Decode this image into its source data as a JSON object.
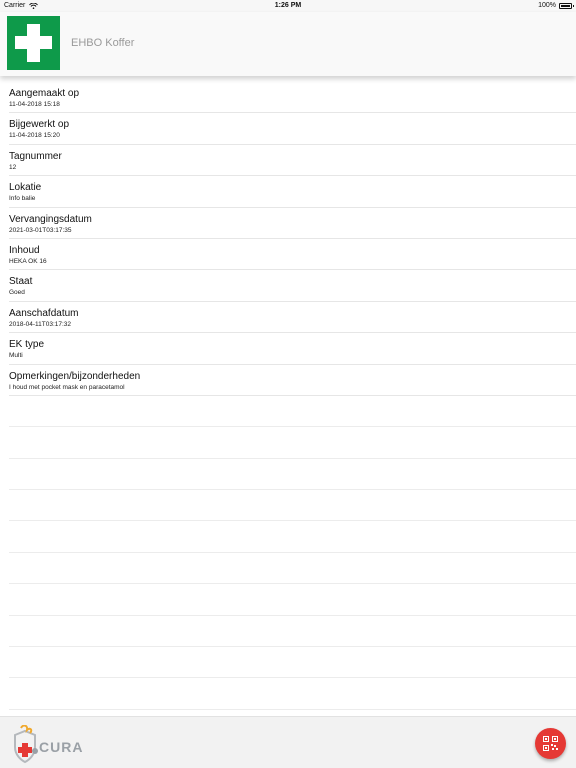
{
  "status_bar": {
    "carrier": "Carrier",
    "time": "1:26 PM",
    "battery": "100%"
  },
  "header": {
    "title": "EHBO Koffer",
    "logo_icon": "first-aid-cross-icon",
    "logo_color": "#0e9a4a"
  },
  "details": [
    {
      "label": "Aangemaakt op",
      "value": "11-04-2018 15:18"
    },
    {
      "label": "Bijgewerkt op",
      "value": "11-04-2018 15:20"
    },
    {
      "label": "Tagnummer",
      "value": "12"
    },
    {
      "label": "Lokatie",
      "value": "Info balie"
    },
    {
      "label": "Vervangingsdatum",
      "value": "2021-03-01T03:17:35"
    },
    {
      "label": "Inhoud",
      "value": "HEKA OK 16"
    },
    {
      "label": "Staat",
      "value": "Goed"
    },
    {
      "label": "Aanschafdatum",
      "value": "2018-04-11T03:17:32"
    },
    {
      "label": "EK type",
      "value": "Multi"
    },
    {
      "label": "Opmerkingen/bijzonderheden",
      "value": "I houd met pocket mask en paracetamol"
    }
  ],
  "footer": {
    "brand": "CURA",
    "qr_button_icon": "qr-code-icon",
    "qr_button_color": "#e53935"
  }
}
